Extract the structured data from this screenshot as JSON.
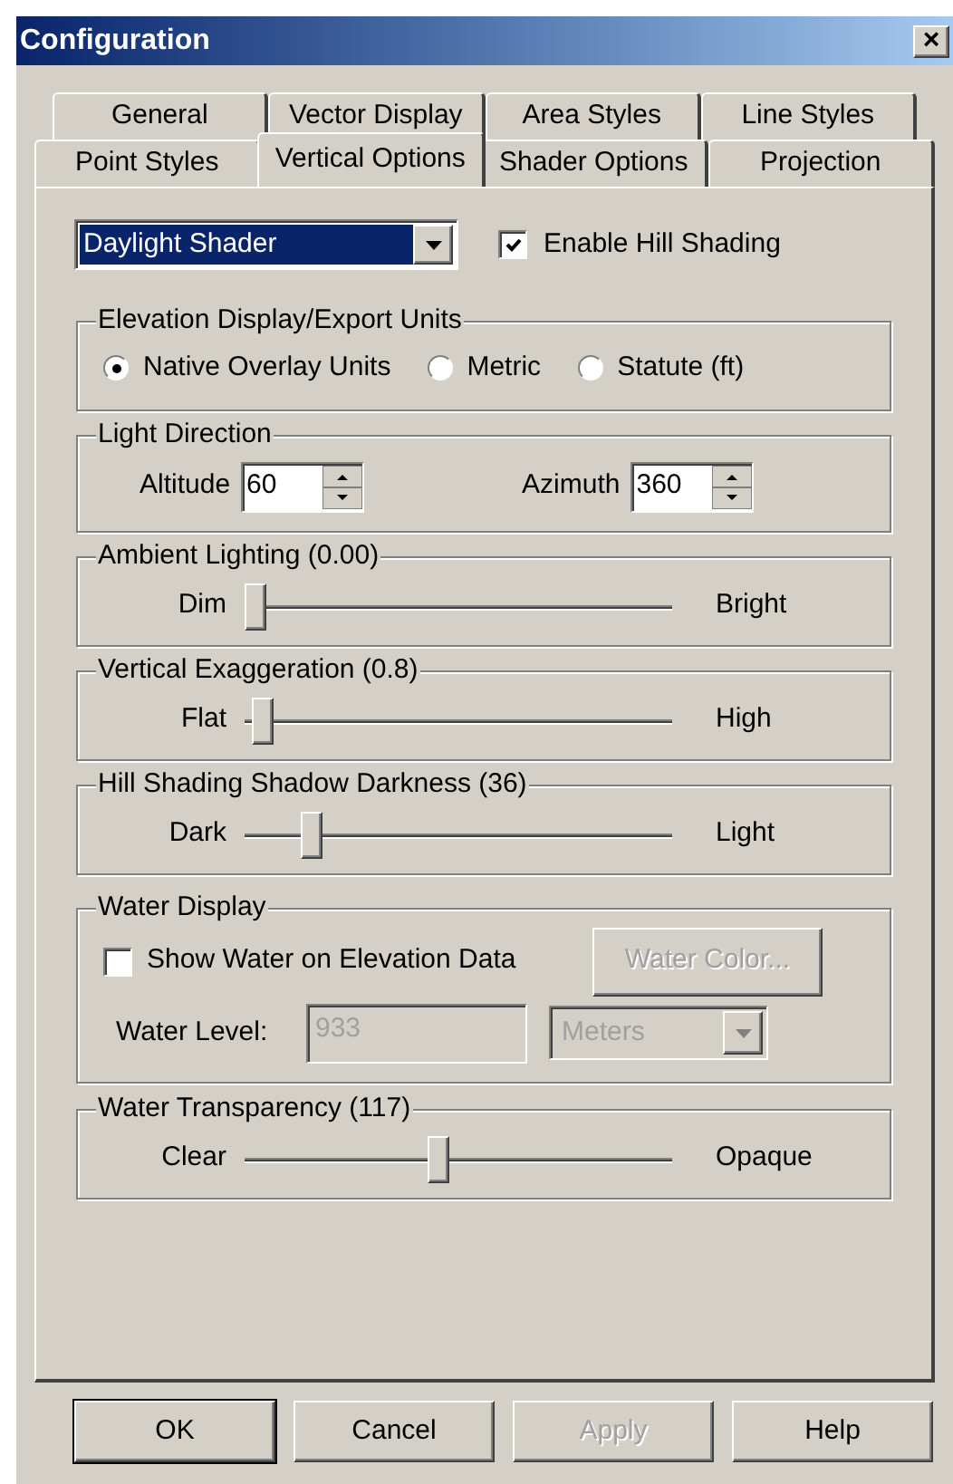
{
  "window": {
    "title": "Configuration",
    "close": "×"
  },
  "tab_rows": [
    [
      {
        "label": "General",
        "selected": false
      },
      {
        "label": "Vector Display",
        "selected": false
      },
      {
        "label": "Area Styles",
        "selected": false
      },
      {
        "label": "Line Styles",
        "selected": false
      }
    ],
    [
      {
        "label": "Point Styles",
        "selected": false
      },
      {
        "label": "Vertical Options",
        "selected": true
      },
      {
        "label": "Shader Options",
        "selected": false
      },
      {
        "label": "Projection",
        "selected": false
      }
    ]
  ],
  "shader": {
    "value": "Daylight Shader"
  },
  "hill_shading": {
    "label": "Enable Hill Shading",
    "checked": true
  },
  "elevation_units": {
    "title": "Elevation Display/Export Units",
    "options": [
      {
        "label": "Native Overlay Units",
        "selected": true
      },
      {
        "label": "Metric",
        "selected": false
      },
      {
        "label": "Statute (ft)",
        "selected": false
      }
    ]
  },
  "light_direction": {
    "title": "Light Direction",
    "fields": [
      {
        "label": "Altitude",
        "value": "60"
      },
      {
        "label": "Azimuth",
        "value": "360"
      }
    ]
  },
  "sliders_top": [
    {
      "title": "Ambient Lighting (0.00)",
      "min_label": "Dim",
      "max_label": "Bright",
      "level": 0
    },
    {
      "title": "Vertical Exaggeration (0.8)",
      "min_label": "Flat",
      "max_label": "High",
      "level": 0.02
    },
    {
      "title": "Hill Shading Shadow Darkness (36)",
      "min_label": "Dark",
      "max_label": "Light",
      "level": 0.14
    }
  ],
  "water_display": {
    "title": "Water Display",
    "show_water": {
      "label": "Show Water on Elevation Data",
      "checked": false
    },
    "color_button": {
      "label": "Water Color...",
      "disabled": true
    },
    "level_label": "Water Level:",
    "level_field": {
      "value": "933",
      "disabled": true
    },
    "units": {
      "value": "Meters",
      "disabled": true
    }
  },
  "sliders_bottom": [
    {
      "title": "Water Transparency (117)",
      "min_label": "Clear",
      "max_label": "Opaque",
      "level": 0.45
    }
  ],
  "buttons": [
    {
      "label": "OK",
      "default": true,
      "disabled": false
    },
    {
      "label": "Cancel",
      "default": false,
      "disabled": false
    },
    {
      "label": "Apply",
      "default": false,
      "disabled": true
    },
    {
      "label": "Help",
      "default": false,
      "disabled": false
    }
  ]
}
